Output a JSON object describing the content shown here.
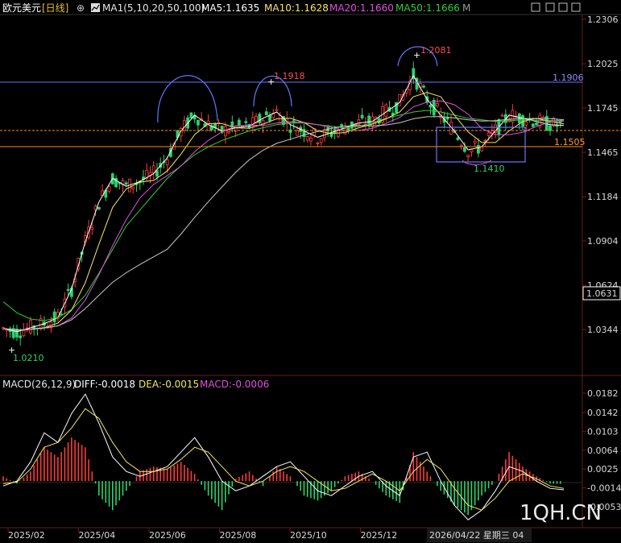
{
  "header": {
    "instrument": "欧元美元",
    "period": "[日线]",
    "ma_label": "MA1(5,10,20,50,100)",
    "ma5": "MA5:1.1635",
    "ma10": "MA10:1.1628",
    "ma20": "MA20:1.1660",
    "ma50": "MA50:1.1666",
    "mode": "M"
  },
  "macd_header": {
    "label": "MACD(26,12,9)",
    "diff": "DIFF:-0.0018",
    "dea": "DEA:-0.0015",
    "macd": "MACD:-0.0006"
  },
  "annotations": {
    "low_start": "1.0210",
    "peak1": "1.1918",
    "peak2": "1.2081",
    "resistance": "1.1906",
    "support": "1.1505",
    "box_low": "1.1410",
    "cursor_date": "2026/04/22 星期三 04",
    "last_price": "1.0631"
  },
  "watermark": "1QH.CN",
  "colors": {
    "up": "#ff3b3b",
    "down": "#2bd36b",
    "ma5": "#ffffff",
    "ma10": "#f5e663",
    "ma20": "#e04ee0",
    "ma50": "#2fd12f",
    "ma100": "#c8c8c8",
    "resistance": "#6f74ff",
    "support": "#ff8c1a"
  },
  "chart_data": [
    {
      "type": "line",
      "title": "欧元美元 [日线]",
      "y_ticks": [
        "1.2306",
        "1.2025",
        "1.1745",
        "1.1465",
        "1.1184",
        "1.0904",
        "1.0624",
        "1.0344"
      ],
      "x_ticks": [
        "2025/02",
        "2025/04",
        "2025/06",
        "2025/08",
        "2025/10",
        "2025/12"
      ],
      "ylim": [
        1.0155,
        1.2306
      ],
      "series": [
        {
          "name": "MA5",
          "values": [
            1.035,
            1.033,
            1.0355,
            1.038,
            1.042,
            1.06,
            1.09,
            1.115,
            1.13,
            1.125,
            1.128,
            1.133,
            1.143,
            1.16,
            1.17,
            1.164,
            1.16,
            1.162,
            1.163,
            1.168,
            1.172,
            1.164,
            1.16,
            1.156,
            1.159,
            1.162,
            1.165,
            1.166,
            1.172,
            1.178,
            1.195,
            1.18,
            1.17,
            1.16,
            1.148,
            1.15,
            1.16,
            1.17,
            1.168,
            1.166,
            1.164,
            1.1635
          ]
        },
        {
          "name": "MA50",
          "values": [
            1.052,
            1.045,
            1.041,
            1.04,
            1.042,
            1.047,
            1.056,
            1.07,
            1.085,
            1.1,
            1.11,
            1.12,
            1.13,
            1.138,
            1.145,
            1.15,
            1.154,
            1.157,
            1.16,
            1.162,
            1.164,
            1.165,
            1.165,
            1.164,
            1.163,
            1.162,
            1.163,
            1.165,
            1.168,
            1.17,
            1.172,
            1.173,
            1.172,
            1.17,
            1.168,
            1.167,
            1.166,
            1.1665,
            1.167,
            1.1668,
            1.1666,
            1.1666
          ]
        }
      ]
    },
    {
      "type": "bar",
      "title": "MACD(26,12,9)",
      "y_ticks": [
        "0.0182",
        "0.0142",
        "0.0103",
        "0.0064",
        "0.0025",
        "-0.0014",
        "-0.0053"
      ],
      "ylim": [
        -0.009,
        0.02
      ],
      "series": [
        {
          "name": "MACD",
          "values": [
            0.001,
            -0.0005,
            0.002,
            0.007,
            0.005,
            0.009,
            0.007,
            -0.003,
            -0.006,
            -0.002,
            0.002,
            0.003,
            0.0025,
            0.004,
            0.0015,
            -0.003,
            -0.006,
            0.0005,
            0.002,
            -0.001,
            0.003,
            0.001,
            -0.003,
            -0.004,
            -0.002,
            0.001,
            0.002,
            0.0,
            -0.003,
            -0.0045,
            0.006,
            0.002,
            -0.002,
            -0.005,
            -0.007,
            -0.003,
            0.0,
            0.006,
            0.003,
            0.001,
            -0.0005,
            -0.0006
          ]
        },
        {
          "name": "DIFF",
          "values": [
            -0.001,
            0.0,
            0.004,
            0.01,
            0.008,
            0.014,
            0.018,
            0.012,
            0.005,
            0.002,
            0.001,
            0.002,
            0.003,
            0.006,
            0.009,
            0.005,
            0.0,
            -0.002,
            -0.001,
            0.001,
            0.003,
            0.004,
            0.001,
            -0.002,
            -0.003,
            -0.001,
            0.001,
            0.002,
            -0.001,
            -0.003,
            0.005,
            0.006,
            0.0,
            -0.005,
            -0.008,
            -0.006,
            -0.002,
            0.003,
            0.002,
            0.0,
            -0.0015,
            -0.0018
          ]
        },
        {
          "name": "DEA",
          "values": [
            -0.0005,
            -0.0002,
            0.0025,
            0.007,
            0.008,
            0.011,
            0.015,
            0.013,
            0.008,
            0.004,
            0.002,
            0.002,
            0.0025,
            0.0045,
            0.007,
            0.006,
            0.003,
            0.0,
            -0.001,
            0.0,
            0.002,
            0.003,
            0.002,
            0.0,
            -0.002,
            -0.0015,
            0.0,
            0.0015,
            0.0,
            -0.002,
            0.002,
            0.0045,
            0.0025,
            -0.0015,
            -0.005,
            -0.006,
            -0.0035,
            0.0,
            0.0015,
            0.0005,
            -0.001,
            -0.0015
          ]
        }
      ]
    }
  ]
}
